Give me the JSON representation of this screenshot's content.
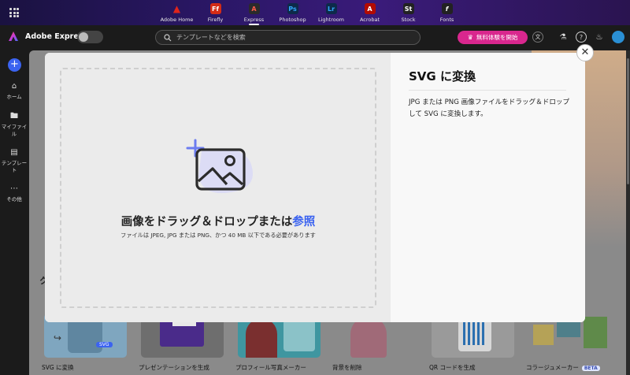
{
  "topbar": {
    "apps": [
      {
        "label": "Adobe Home",
        "glyph": "A",
        "color": "#e1251b",
        "active": false
      },
      {
        "label": "Firefly",
        "glyph": "Ff",
        "color": "#d42c16",
        "active": false
      },
      {
        "label": "Express",
        "glyph": "A",
        "color": "#2b2b2b",
        "active": true
      },
      {
        "label": "Photoshop",
        "glyph": "Ps",
        "color": "#0d2a4a",
        "active": false
      },
      {
        "label": "Lightroom",
        "glyph": "Lr",
        "color": "#0d2a4a",
        "active": false
      },
      {
        "label": "Acrobat",
        "glyph": "A",
        "color": "#b30b00",
        "active": false
      },
      {
        "label": "Stock",
        "glyph": "St",
        "color": "#222222",
        "active": false
      },
      {
        "label": "Fonts",
        "glyph": "f",
        "color": "#222222",
        "active": false
      }
    ]
  },
  "header": {
    "brand": "Adobe Express",
    "search_placeholder": "テンプレートなどを検索",
    "trial_label": "無料体験を開始"
  },
  "sidebar": {
    "items": [
      {
        "label": "ホーム",
        "icon": "home-icon"
      },
      {
        "label": "マイファイル",
        "icon": "folder-icon"
      },
      {
        "label": "テンプレート",
        "icon": "template-icon"
      },
      {
        "label": "その他",
        "icon": "more-icon"
      }
    ]
  },
  "background": {
    "section_heading_partial": "ク",
    "cards": [
      {
        "label": "SVG に変換",
        "beta": ""
      },
      {
        "label": "プレゼンテーションを生成",
        "beta": ""
      },
      {
        "label": "プロフィール写真メーカー",
        "beta": ""
      },
      {
        "label": "背景を削除",
        "beta": ""
      },
      {
        "label": "QR コードを生成",
        "beta": ""
      },
      {
        "label": "コラージュメーカー",
        "beta": "BETA"
      }
    ],
    "svg_badge": "SVG"
  },
  "modal": {
    "drop_title": "画像をドラッグ＆ドロップまたは",
    "drop_link": "参照",
    "drop_sub": "ファイルは JPEG, JPG または PNG、かつ 40 MB 以下である必要があります",
    "title": "SVG に変換",
    "description": "JPG または PNG 画像ファイルをドラッグ＆ドロップして SVG に変換します。",
    "close_glyph": "✕"
  },
  "colors": {
    "accent": "#3b63f0",
    "trial": "#d9278e"
  }
}
